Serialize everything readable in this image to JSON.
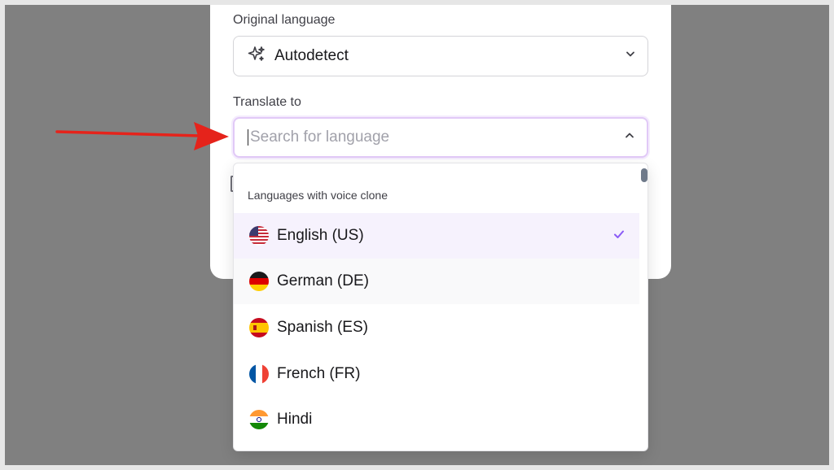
{
  "original_language": {
    "label": "Original language",
    "value": "Autodetect",
    "icon": "sparkles-icon"
  },
  "translate_to": {
    "label": "Translate to",
    "search_placeholder": "Search for language",
    "search_value": ""
  },
  "dropdown": {
    "group_header": "Languages with voice clone",
    "options": [
      {
        "label": "English (US)",
        "flag": "us-flag-icon",
        "selected": true
      },
      {
        "label": "German (DE)",
        "flag": "de-flag-icon",
        "selected": false
      },
      {
        "label": "Spanish (ES)",
        "flag": "es-flag-icon",
        "selected": false
      },
      {
        "label": "French (FR)",
        "flag": "fr-flag-icon",
        "selected": false
      },
      {
        "label": "Hindi",
        "flag": "in-flag-icon",
        "selected": false
      }
    ]
  },
  "colors": {
    "accent": "#8b5cf6",
    "annotation_arrow": "#e5231b",
    "backdrop": "#808080"
  }
}
